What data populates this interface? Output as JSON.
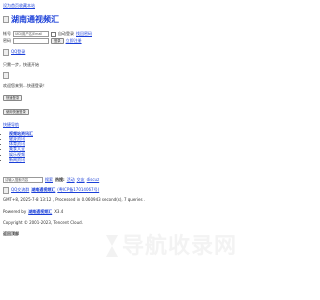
{
  "top": {
    "link": "设为首页收藏本站"
  },
  "logo": {
    "alt": "湖南通视频汇"
  },
  "login": {
    "username_label": "帐号",
    "username_placeholder": "UID/用户名/Email",
    "remember_label": "自动登录",
    "forgot_link": "找回密码",
    "password_label": "密码",
    "login_button": "登录",
    "register_link": "立即注册"
  },
  "qq_login": {
    "alt": "QQ登录"
  },
  "quick_start": {
    "text": "只需一步，快速开始"
  },
  "welcome": {
    "text": "欢迎您来到...快速登录！",
    "button": "快速登录"
  },
  "fast_login": {
    "button": "使用快速登录"
  },
  "quick_nav": {
    "title": "快捷导航",
    "items": [
      "视频站资讯汇",
      "健身资讯",
      "体育资讯",
      "美食大全",
      "娱乐视频",
      "新闻资讯"
    ]
  },
  "search": {
    "placeholder": "请输入搜索内容",
    "button": "搜索",
    "hot_label": "热搜:",
    "hot_links": [
      "活动",
      "交友",
      "discuz"
    ]
  },
  "footer": {
    "line1_prefix": "QQ交流群",
    "line1_link": "湖南通视频汇",
    "line1_suffix": "(粤ICP备17014067号)",
    "gmt_line": "GMT+8, 2025-7-8 13:12 , Processed in 0.060943 second(s), 7 queries .",
    "powered_prefix": "Powered by",
    "powered_link": "湖南通视频汇",
    "powered_version": "X3.4",
    "copyright": "Copyright © 2001-2023, Tencent Cloud.",
    "back_top": "返回顶部"
  },
  "banner": {
    "text": "导航收录网"
  },
  "colors": {
    "link": "#1a3fd8",
    "banner_bg": "#ffffff"
  }
}
